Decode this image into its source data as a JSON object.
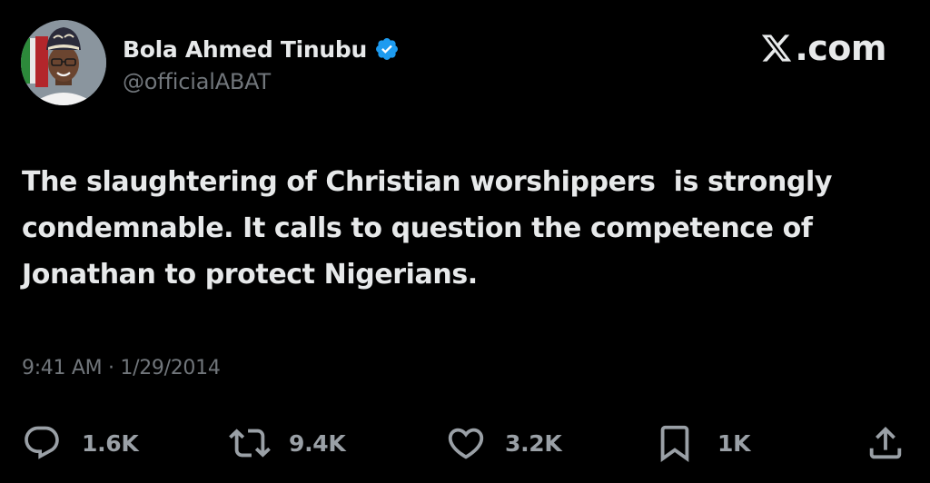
{
  "author": {
    "display_name": "Bola Ahmed Tinubu",
    "handle": "@officialABAT",
    "verified": true,
    "avatar_icon": "profile-photo"
  },
  "brand": {
    "logo_icon": "x-logo-icon",
    "text": ".com"
  },
  "tweet": {
    "text": "The slaughtering of Christian worshippers  is strongly\ncondemnable. It calls to question the competence of\nJonathan to protect Nigerians.",
    "timestamp": "9:41 AM · 1/29/2014"
  },
  "actions": {
    "reply": {
      "icon": "reply-icon",
      "count": "1.6K"
    },
    "repost": {
      "icon": "repost-icon",
      "count": "9.4K"
    },
    "like": {
      "icon": "heart-icon",
      "count": "3.2K"
    },
    "bookmark": {
      "icon": "bookmark-icon",
      "count": "1K"
    },
    "share": {
      "icon": "share-icon"
    }
  },
  "colors": {
    "background": "#000000",
    "text_primary": "#e7e9ea",
    "text_secondary": "#71767b",
    "verified_badge": "#1d9bf0"
  }
}
